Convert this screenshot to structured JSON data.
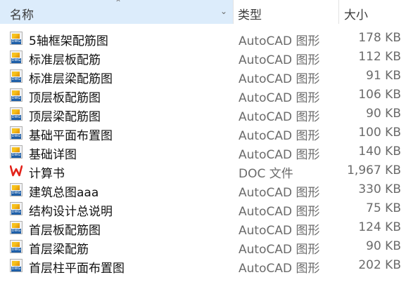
{
  "header": {
    "name_label": "名称",
    "type_label": "类型",
    "size_label": "大小",
    "sort_icon": "chevron-up-icon",
    "filter_icon": "chevron-down-icon",
    "active_bg": "#dcecfb"
  },
  "files": [
    {
      "name": "5轴框架配筋图",
      "type": "AutoCAD 图形",
      "size": "178 KB",
      "icon": "dwg-file-icon"
    },
    {
      "name": "标准层板配筋",
      "type": "AutoCAD 图形",
      "size": "112 KB",
      "icon": "dwg-file-icon"
    },
    {
      "name": "标准层梁配筋图",
      "type": "AutoCAD 图形",
      "size": "91 KB",
      "icon": "dwg-file-icon"
    },
    {
      "name": "顶层板配筋图",
      "type": "AutoCAD 图形",
      "size": "106 KB",
      "icon": "dwg-file-icon"
    },
    {
      "name": "顶层梁配筋图",
      "type": "AutoCAD 图形",
      "size": "90 KB",
      "icon": "dwg-file-icon"
    },
    {
      "name": "基础平面布置图",
      "type": "AutoCAD 图形",
      "size": "100 KB",
      "icon": "dwg-file-icon"
    },
    {
      "name": "基础详图",
      "type": "AutoCAD 图形",
      "size": "140 KB",
      "icon": "dwg-file-icon"
    },
    {
      "name": "计算书",
      "type": "DOC 文件",
      "size": "1,967 KB",
      "icon": "wps-doc-icon"
    },
    {
      "name": "建筑总图aaa",
      "type": "AutoCAD 图形",
      "size": "330 KB",
      "icon": "dwg-file-icon"
    },
    {
      "name": "结构设计总说明",
      "type": "AutoCAD 图形",
      "size": "75 KB",
      "icon": "dwg-file-icon"
    },
    {
      "name": "首层板配筋图",
      "type": "AutoCAD 图形",
      "size": "124 KB",
      "icon": "dwg-file-icon"
    },
    {
      "name": "首层梁配筋",
      "type": "AutoCAD 图形",
      "size": "90 KB",
      "icon": "dwg-file-icon"
    },
    {
      "name": "首层柱平面布置图",
      "type": "AutoCAD 图形",
      "size": "202 KB",
      "icon": "dwg-file-icon"
    }
  ]
}
